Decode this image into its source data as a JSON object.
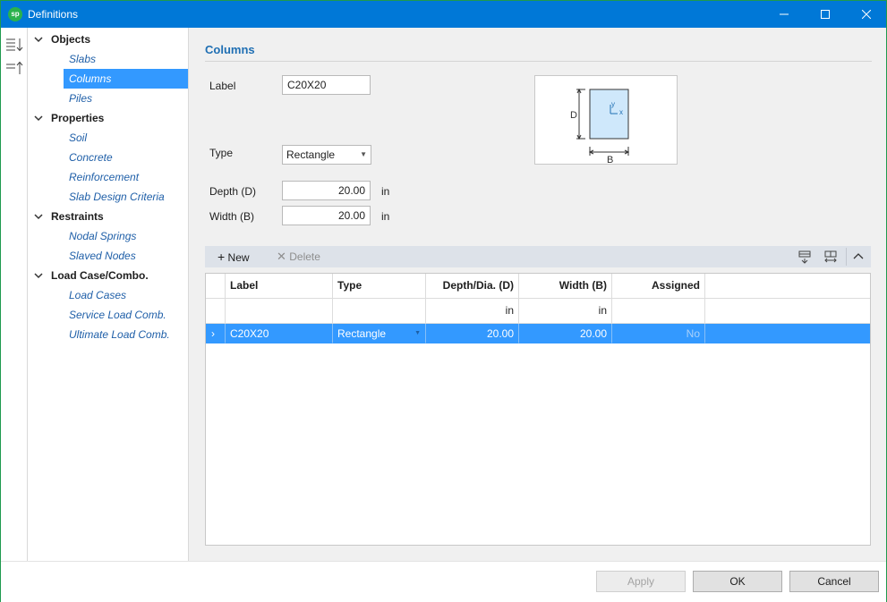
{
  "window": {
    "title": "Definitions",
    "app_icon_text": "sp"
  },
  "tree": {
    "groups": [
      {
        "label": "Objects",
        "items": [
          "Slabs",
          "Columns",
          "Piles"
        ]
      },
      {
        "label": "Properties",
        "items": [
          "Soil",
          "Concrete",
          "Reinforcement",
          "Slab Design Criteria"
        ]
      },
      {
        "label": "Restraints",
        "items": [
          "Nodal Springs",
          "Slaved Nodes"
        ]
      },
      {
        "label": "Load Case/Combo.",
        "items": [
          "Load Cases",
          "Service Load Comb.",
          "Ultimate Load Comb."
        ]
      }
    ],
    "selected": "Columns"
  },
  "form": {
    "section_title": "Columns",
    "label_caption": "Label",
    "label_value": "C20X20",
    "type_caption": "Type",
    "type_value": "Rectangle",
    "depth_caption": "Depth (D)",
    "depth_value": "20.00",
    "depth_unit": "in",
    "width_caption": "Width (B)",
    "width_value": "20.00",
    "width_unit": "in"
  },
  "preview": {
    "dim_d": "D",
    "dim_b": "B",
    "axis_y": "y",
    "axis_x": "x",
    "fill_color": "#cfe8fb",
    "stroke_color": "#333333"
  },
  "grid_toolbar": {
    "new_label": "New",
    "delete_label": "Delete"
  },
  "grid": {
    "headers": [
      "Label",
      "Type",
      "Depth/Dia. (D)",
      "Width (B)",
      "Assigned"
    ],
    "units": [
      "",
      "",
      "in",
      "in",
      ""
    ],
    "rows": [
      {
        "label": "C20X20",
        "type": "Rectangle",
        "depth": "20.00",
        "width": "20.00",
        "assigned": "No"
      }
    ],
    "selected_color": "#3399ff"
  },
  "footer": {
    "apply_label": "Apply",
    "ok_label": "OK",
    "cancel_label": "Cancel"
  },
  "colors": {
    "titlebar": "#0078d7",
    "accent": "#1f6fb3",
    "link": "#1f5fa8"
  }
}
